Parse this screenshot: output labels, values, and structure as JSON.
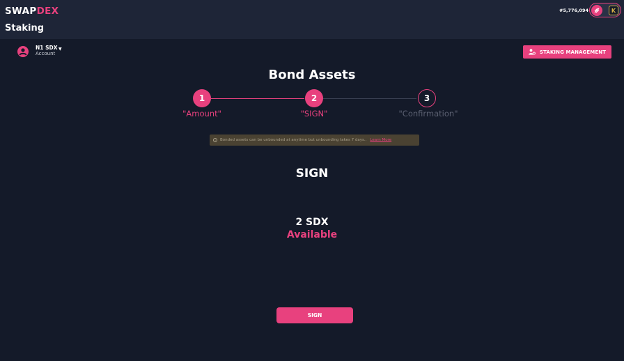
{
  "header": {
    "logo_white": "SWAP",
    "logo_pink": "DEX",
    "page_title": "Staking",
    "block_number": "#5,776,094",
    "wallet_right_glyph": "K"
  },
  "account": {
    "name": "N1 SDX",
    "label": "Account"
  },
  "toolbar": {
    "staking_management_label": "STAKING MANAGEMENT"
  },
  "main": {
    "heading": "Bond Assets",
    "steps": [
      {
        "number": "1",
        "label": "\"Amount\"",
        "state": "done"
      },
      {
        "number": "2",
        "label": "\"SIGN\"",
        "state": "current"
      },
      {
        "number": "3",
        "label": "\"Confirmation\"",
        "state": "pending"
      }
    ],
    "info_text": "Bonded assets can be unbounded at anytime but unbounding takes 7 days..",
    "info_link": "Learn More",
    "sign_title": "SIGN",
    "amount": "2 SDX",
    "available_label": "Available",
    "sign_button_label": "SIGN"
  },
  "colors": {
    "accent": "#e8417e",
    "background": "#141a29",
    "topbar": "#1e2537",
    "inactive_text": "#5c6172",
    "banner": "#4a4232"
  },
  "icons": {
    "avatar": "user-circle-icon",
    "account_caret": "caret-down-icon",
    "management": "user-gear-icon",
    "info": "info-icon",
    "wallet_left": "polkadot-icon",
    "wallet_right": "kusama-icon"
  }
}
